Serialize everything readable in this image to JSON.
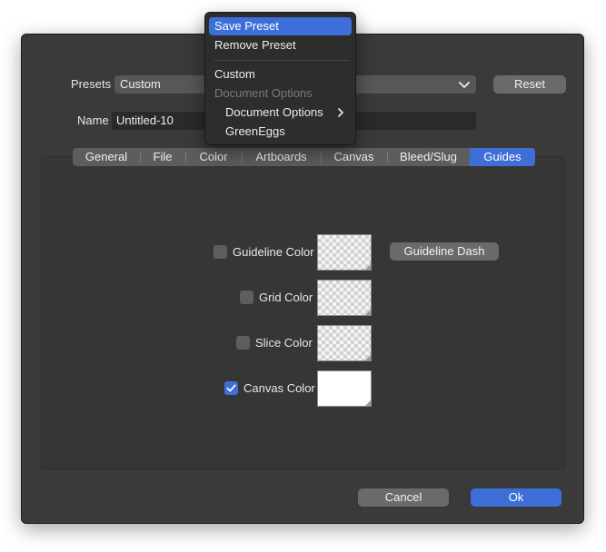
{
  "presets": {
    "label": "Presets",
    "value": "Custom",
    "reset_label": "Reset"
  },
  "name": {
    "label": "Name",
    "value": "Untitled-10"
  },
  "tabs": [
    {
      "label": "General",
      "active": false
    },
    {
      "label": "File",
      "active": false
    },
    {
      "label": "Color",
      "active": false
    },
    {
      "label": "Artboards",
      "active": false
    },
    {
      "label": "Canvas",
      "active": false
    },
    {
      "label": "Bleed/Slug",
      "active": false
    },
    {
      "label": "Guides",
      "active": true
    }
  ],
  "guides": {
    "guideline_color": {
      "label": "Guideline Color",
      "checked": false
    },
    "guideline_dash_label": "Guideline Dash",
    "grid_color": {
      "label": "Grid Color",
      "checked": false
    },
    "slice_color": {
      "label": "Slice Color",
      "checked": false
    },
    "canvas_color": {
      "label": "Canvas Color",
      "checked": true,
      "swatch": "#ffffff"
    }
  },
  "footer": {
    "cancel_label": "Cancel",
    "ok_label": "Ok"
  },
  "menu": {
    "items": [
      {
        "label": "Save Preset",
        "state": "highlighted"
      },
      {
        "label": "Remove Preset",
        "state": "normal"
      },
      {
        "label": "Custom",
        "state": "normal"
      },
      {
        "label": "Document Options",
        "state": "disabled"
      },
      {
        "label": "Document Options",
        "state": "submenu"
      },
      {
        "label": "GreenEggs",
        "state": "normal"
      }
    ]
  },
  "colors": {
    "accent": "#3e6fd8",
    "dialog_bg": "#3a3a3a",
    "button_bg": "#6a6a6a"
  }
}
